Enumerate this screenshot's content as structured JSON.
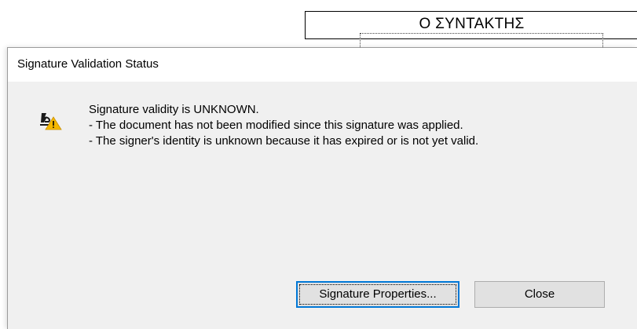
{
  "background_document": {
    "heading": "Ο ΣΥΝΤΑΚΤΗΣ"
  },
  "dialog": {
    "title": "Signature Validation Status",
    "icon": "signature-warning-icon",
    "message": {
      "headline": "Signature validity is UNKNOWN.",
      "line1": "- The document has not been modified since this signature was applied.",
      "line2": "- The signer's identity is unknown because it has expired or is not yet valid."
    },
    "buttons": {
      "properties_label": "Signature Properties...",
      "close_label": "Close"
    }
  },
  "colors": {
    "dialog_bg": "#f0f0f0",
    "titlebar_bg": "#ffffff",
    "focus_border": "#0078d7",
    "warning_triangle": "#f5b800"
  }
}
